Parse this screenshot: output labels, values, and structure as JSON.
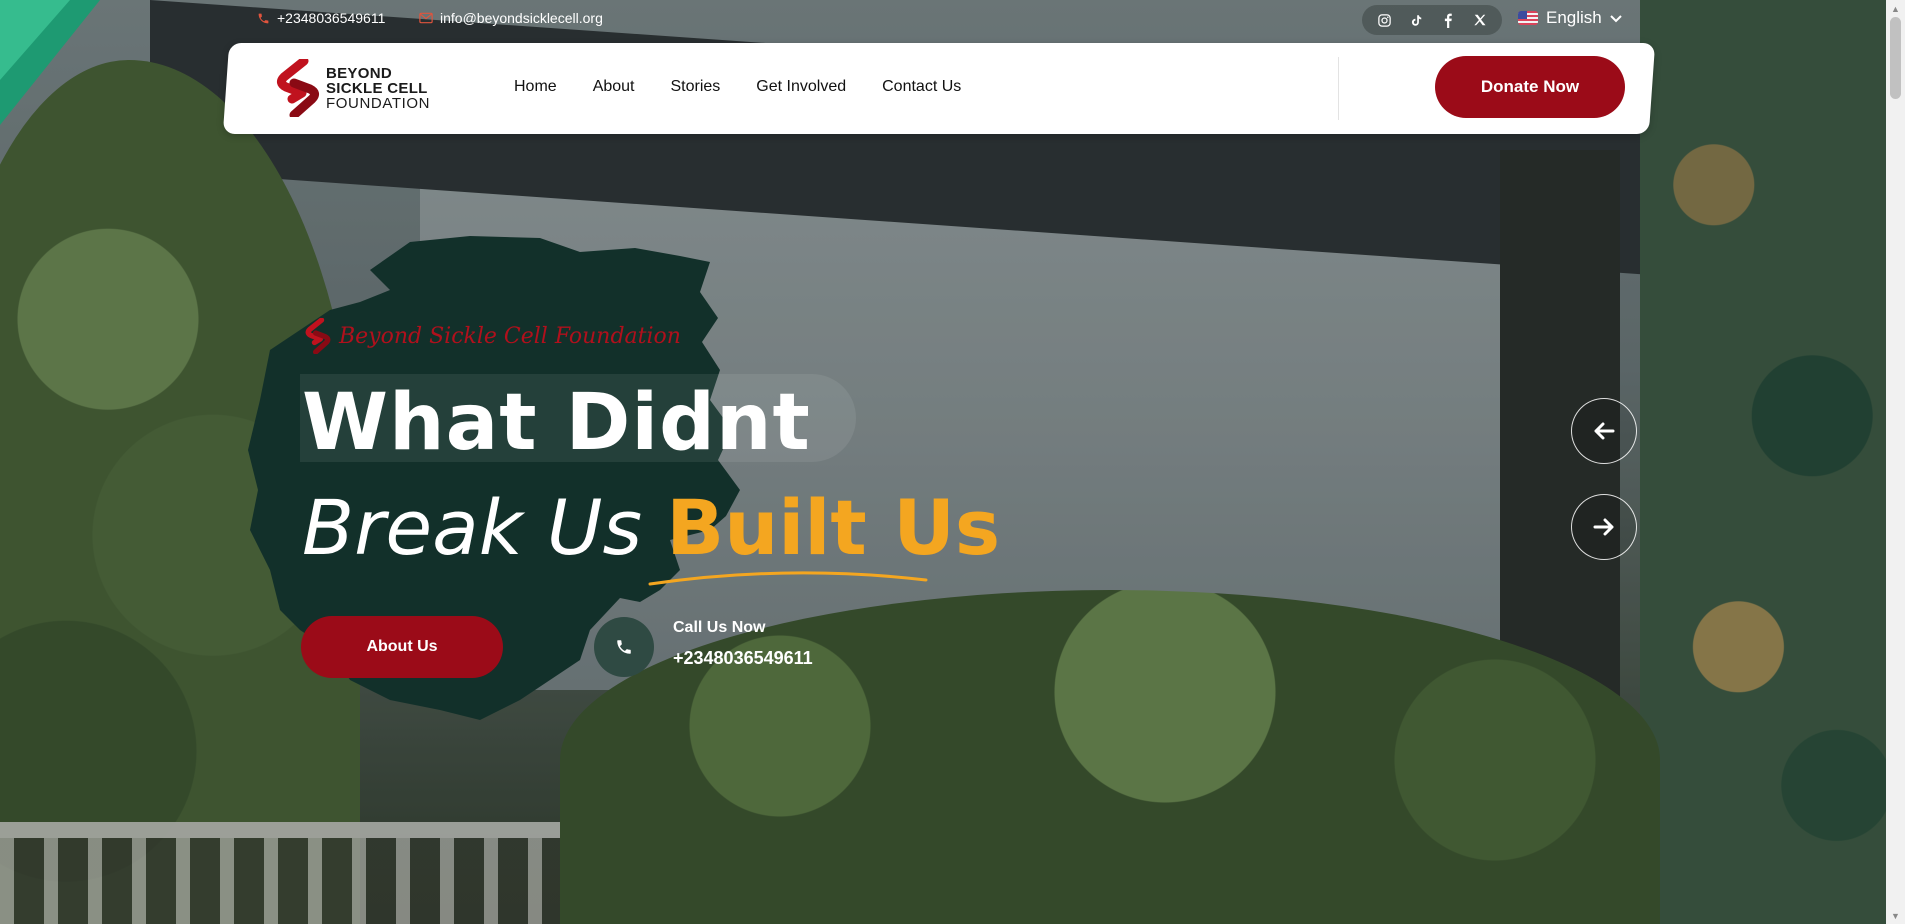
{
  "topbar": {
    "phone": "+2348036549611",
    "email": "info@beyondsicklecell.org",
    "social_icons": [
      "instagram-icon",
      "tiktok-icon",
      "facebook-icon",
      "x-icon"
    ],
    "language": "English"
  },
  "logo": {
    "line1": "BEYOND",
    "line2": "SICKLE CELL",
    "line3": "FOUNDATION"
  },
  "nav": {
    "items": [
      "Home",
      "About",
      "Stories",
      "Get Involved",
      "Contact Us"
    ],
    "donate_label": "Donate Now"
  },
  "hero": {
    "kicker": "Beyond Sickle Cell Foundation",
    "title_line1": "What Didnt",
    "title_line2_plain": "Break Us ",
    "title_line2_accent": "Built Us",
    "about_label": "About Us",
    "call_label": "Call Us Now",
    "call_number": "+2348036549611"
  },
  "colors": {
    "brand_red": "#9b0b18",
    "accent_yellow": "#f4a620",
    "hero_green": "#12302a",
    "corner_green": "#1e9a72"
  }
}
